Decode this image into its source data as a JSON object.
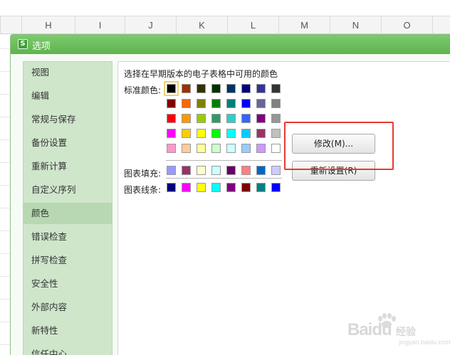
{
  "spreadsheet": {
    "columns": [
      "H",
      "I",
      "J",
      "K",
      "L",
      "M",
      "N",
      "O"
    ]
  },
  "dialog": {
    "icon_letter": "S",
    "title": "选项",
    "sidebar": {
      "items": [
        {
          "label": "视图"
        },
        {
          "label": "编辑"
        },
        {
          "label": "常规与保存"
        },
        {
          "label": "备份设置"
        },
        {
          "label": "重新计算"
        },
        {
          "label": "自定义序列"
        },
        {
          "label": "颜色",
          "active": true
        },
        {
          "label": "错误检查"
        },
        {
          "label": "拼写检查"
        },
        {
          "label": "安全性"
        },
        {
          "label": "外部内容"
        },
        {
          "label": "新特性"
        },
        {
          "label": "信任中心"
        }
      ]
    },
    "colors_panel": {
      "heading": "选择在早期版本的电子表格中可用的颜色",
      "standard_label": "标准颜色:",
      "standard_colors": [
        [
          "#000000",
          "#993300",
          "#333300",
          "#003300",
          "#003366",
          "#000080",
          "#333399",
          "#333333"
        ],
        [
          "#800000",
          "#ff6600",
          "#808000",
          "#008000",
          "#008080",
          "#0000ff",
          "#666699",
          "#808080"
        ],
        [
          "#ff0000",
          "#ff9900",
          "#99cc00",
          "#339966",
          "#33cccc",
          "#3366ff",
          "#800080",
          "#969696"
        ],
        [
          "#ff00ff",
          "#ffcc00",
          "#ffff00",
          "#00ff00",
          "#00ffff",
          "#00ccff",
          "#993366",
          "#c0c0c0"
        ],
        [
          "#ff99cc",
          "#ffcc99",
          "#ffff99",
          "#ccffcc",
          "#ccffff",
          "#99ccff",
          "#cc99ff",
          "#ffffff"
        ]
      ],
      "selected_color": "#000000",
      "chart_fill_label": "图表填充:",
      "chart_fill_colors": [
        "#9999ff",
        "#993366",
        "#ffffcc",
        "#ccffff",
        "#660066",
        "#ff8080",
        "#0066cc",
        "#ccccff"
      ],
      "chart_line_label": "图表线条:",
      "chart_line_colors": [
        "#000080",
        "#ff00ff",
        "#ffff00",
        "#00ffff",
        "#800080",
        "#800000",
        "#008080",
        "#0000ff"
      ],
      "modify_button": "修改(M)...",
      "reset_button": "重新设置(R)",
      "highlight_color": "#e63a33"
    }
  },
  "watermark": {
    "brand": "Baidu",
    "suffix": "经验",
    "url": "jingyan.baidu.com"
  },
  "theme": {
    "titlebar_green": "#5fb34f",
    "sidebar_green": "#cfe6cb",
    "active_item_green": "#b7d8b0"
  }
}
